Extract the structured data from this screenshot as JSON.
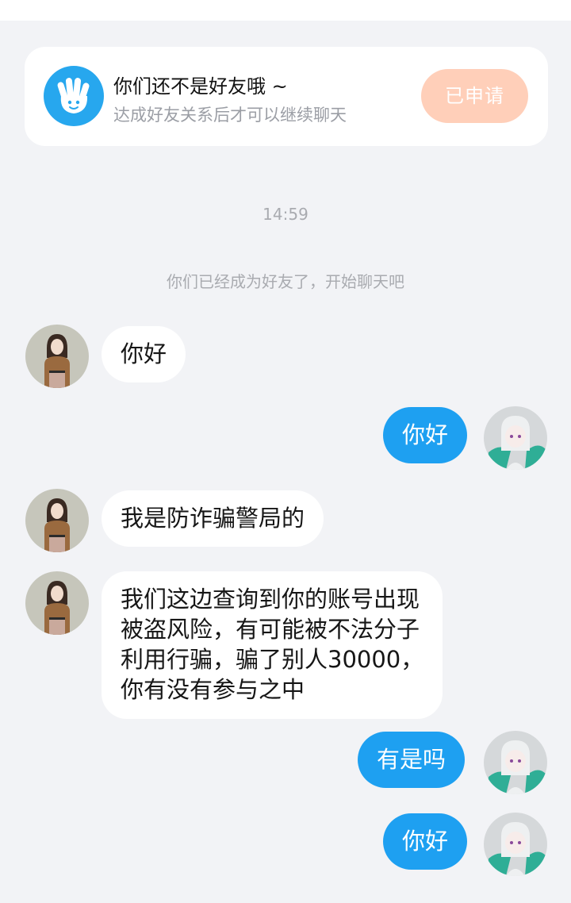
{
  "banner": {
    "title": "你们还不是好友哦 ~",
    "subtitle": "达成好友关系后才可以继续聊天",
    "button_label": "已申请"
  },
  "chat": {
    "timestamp": "14:59",
    "system_notice": "你们已经成为好友了，开始聊天吧",
    "messages": [
      {
        "sender": "other",
        "text": "你好"
      },
      {
        "sender": "me",
        "text": "你好"
      },
      {
        "sender": "other",
        "text": "我是防诈骗警局的"
      },
      {
        "sender": "other",
        "lines": [
          "我们这边查询到你的账号出现",
          "被盗风险，有可能被不法分子",
          "利用行骗，骗了别人30000，",
          "你有没有参与之中"
        ]
      },
      {
        "sender": "me",
        "text": "有是吗"
      },
      {
        "sender": "me",
        "text": "你好"
      }
    ]
  },
  "colors": {
    "background": "#f2f3f6",
    "outgoing_bubble": "#1ea0f1",
    "incoming_bubble": "#ffffff",
    "applied_button": "#ffcfb9",
    "badge": "#27a7ee"
  }
}
